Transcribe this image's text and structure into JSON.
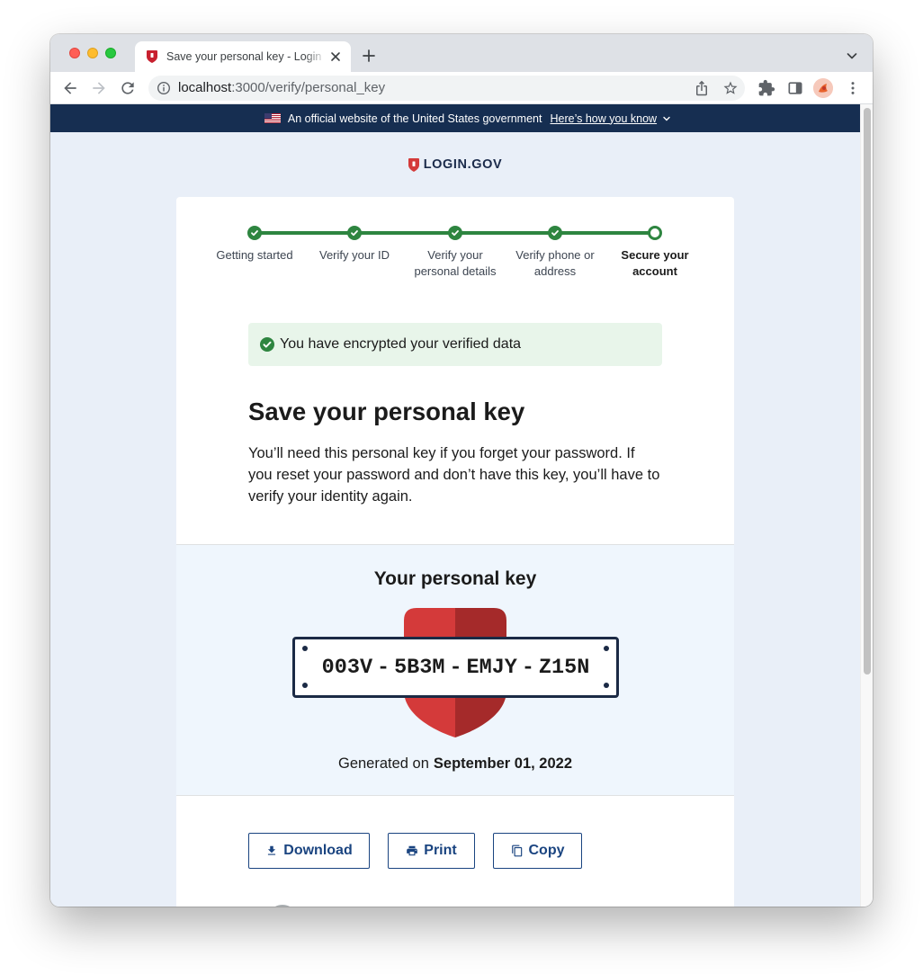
{
  "browser": {
    "tab": {
      "title": "Save your personal key - Login"
    },
    "url": {
      "host": "localhost",
      "path": ":3000/verify/personal_key"
    }
  },
  "gov_banner": {
    "text": "An official website of the United States government",
    "link": "Here’s how you know"
  },
  "logo": {
    "text": "LOGIN.GOV"
  },
  "steps": [
    {
      "label": "Getting started",
      "status": "complete"
    },
    {
      "label": "Verify your ID",
      "status": "complete"
    },
    {
      "label": "Verify your personal details",
      "status": "complete"
    },
    {
      "label": "Verify phone or address",
      "status": "complete"
    },
    {
      "label": "Secure your account",
      "status": "current"
    }
  ],
  "alert": {
    "type": "success",
    "text": "You have encrypted your verified data"
  },
  "heading": "Save your personal key",
  "intro_lines": [
    "You’ll need this personal key if you forget your password. If",
    "you reset your password and don’t have this key, you’ll have to",
    "verify your identity again."
  ],
  "personal_key": {
    "heading": "Your personal key",
    "groups": [
      "003V",
      "5B3M",
      "EMJY",
      "Z15N"
    ],
    "separator": "-",
    "generated_label": "Generated on",
    "generated_date": "September 01, 2022"
  },
  "actions": {
    "download": "Download",
    "print": "Print",
    "copy": "Copy"
  },
  "icons": {
    "browser": [
      "back-arrow-icon",
      "forward-arrow-icon",
      "reload-icon",
      "info-icon",
      "share-icon",
      "star-icon",
      "extensions-puzzle-icon",
      "side-panel-icon",
      "avatar",
      "more-vert-icon",
      "tab-close-icon",
      "new-tab-plus-icon",
      "tab-search-chevron-icon"
    ],
    "page": [
      "us-flag-icon",
      "chevron-down-icon",
      "login-gov-shield-icon",
      "check-circle-icon",
      "download-icon",
      "print-icon",
      "copy-icon",
      "shield-graphic"
    ]
  },
  "colors": {
    "gov_banner": "#162e51",
    "page_background": "#e9eff8",
    "success": "#2e8540",
    "success_alert_bg": "#e8f5ea",
    "primary": "#1a4480",
    "key_section_bg": "#eff6fd",
    "shield_left": "#d43a3a",
    "shield_right": "#a52a2a"
  }
}
